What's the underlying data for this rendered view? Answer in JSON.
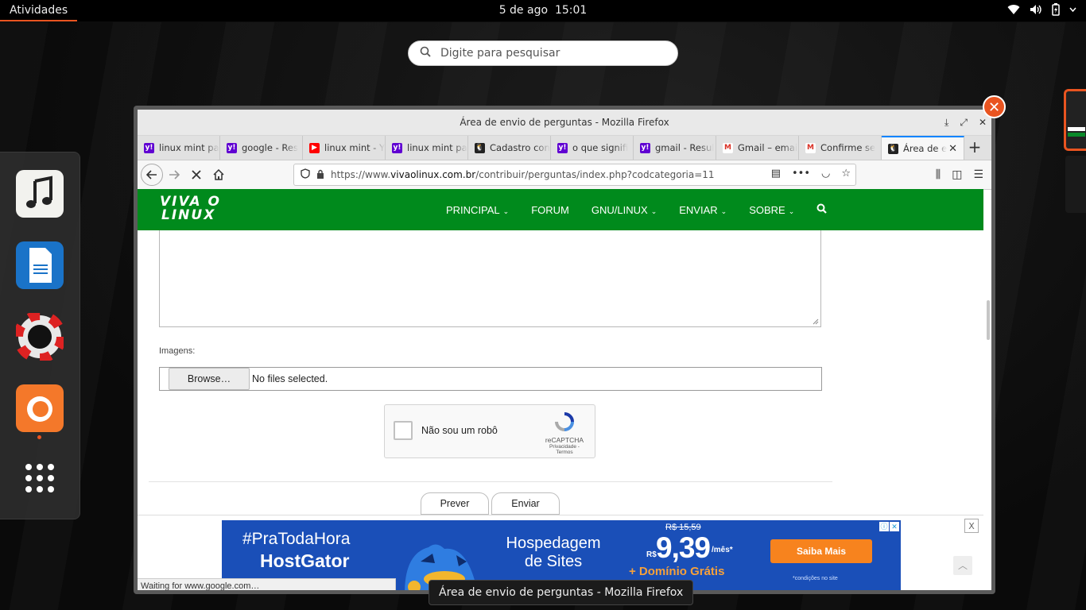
{
  "topbar": {
    "activities": "Atividades",
    "date": "5 de ago",
    "time": "15:01"
  },
  "search": {
    "placeholder": "Digite para pesquisar"
  },
  "dock": {
    "apps": [
      "rhythmbox-icon",
      "writer-icon",
      "help-icon",
      "firefox-icon",
      "show-apps-icon"
    ]
  },
  "window": {
    "title": "Área de envio de perguntas - Mozilla Firefox",
    "tabs": [
      {
        "label": "linux mint pa",
        "icon": "yahoo"
      },
      {
        "label": "google - Res",
        "icon": "yahoo"
      },
      {
        "label": "linux mint - Y",
        "icon": "youtube"
      },
      {
        "label": "linux mint pa",
        "icon": "yahoo"
      },
      {
        "label": "Cadastro con",
        "icon": "tux"
      },
      {
        "label": "o que signifi",
        "icon": "yahoo"
      },
      {
        "label": "gmail - Resul",
        "icon": "yahoo"
      },
      {
        "label": "Gmail – emai",
        "icon": "gmail"
      },
      {
        "label": "Confirme se",
        "icon": "gmail"
      },
      {
        "label": "Área de e",
        "icon": "tux"
      }
    ],
    "url": {
      "prefix": "https://www.",
      "host": "vivaolinux.com.br",
      "path": "/contribuir/perguntas/index.php?codcategoria=11"
    },
    "status": "Waiting for www.google.com…"
  },
  "site": {
    "logo_line1": "VIVA O",
    "logo_line2": "LINUX",
    "menu": [
      "PRINCIPAL",
      "FORUM",
      "GNU/LINUX",
      "ENVIAR",
      "SOBRE"
    ],
    "images_label": "Imagens:",
    "browse_label": "Browse…",
    "no_files": "No files selected.",
    "captcha_text": "Não sou um robô",
    "captcha_brand": "reCAPTCHA",
    "captcha_links": "Privacidade - Termos",
    "preview_label": "Prever",
    "submit_label": "Enviar"
  },
  "ad": {
    "hashtag": "#PraTodaHora",
    "brand": "HostGator",
    "headline1": "Hospedagem",
    "headline2": "de Sites",
    "old_price": "R$ 15,59",
    "currency": "R$",
    "price": "9,39",
    "per": "/mês*",
    "bonus": "+ Domínio Grátis",
    "cta": "Saiba Mais",
    "fine_print": "*condições no site",
    "close": "X"
  },
  "tooltip": "Área de envio de perguntas - Mozilla Firefox",
  "colors": {
    "accent": "#e95420",
    "site_green": "#008a1c",
    "ad_blue": "#1a4fb8",
    "ad_orange": "#f7831e"
  }
}
